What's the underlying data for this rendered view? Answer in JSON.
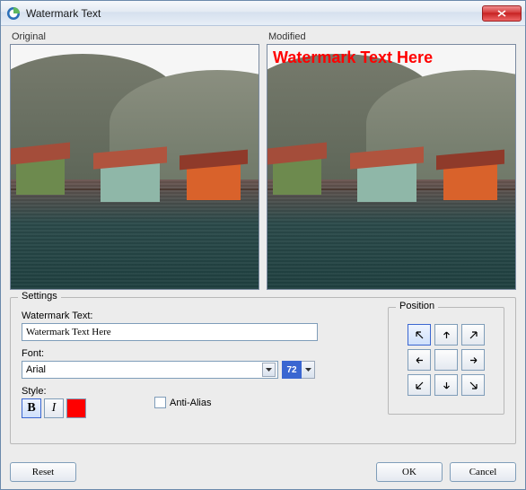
{
  "window": {
    "title": "Watermark Text"
  },
  "panes": {
    "original_label": "Original",
    "modified_label": "Modified",
    "watermark_preview_text": "Watermark Text Here",
    "watermark_color": "#ff0000"
  },
  "settings": {
    "legend": "Settings",
    "watermark_text_label": "Watermark Text:",
    "watermark_text_value": "Watermark Text Here",
    "font_label": "Font:",
    "font_value": "Arial",
    "font_size": "72",
    "style_label": "Style:",
    "bold_glyph": "B",
    "italic_glyph": "I",
    "color_swatch": "#ff0000",
    "antialias_label": "Anti-Alias",
    "antialias_checked": false
  },
  "position": {
    "legend": "Position",
    "selected": "top-left"
  },
  "buttons": {
    "reset": "Reset",
    "ok": "OK",
    "cancel": "Cancel"
  }
}
